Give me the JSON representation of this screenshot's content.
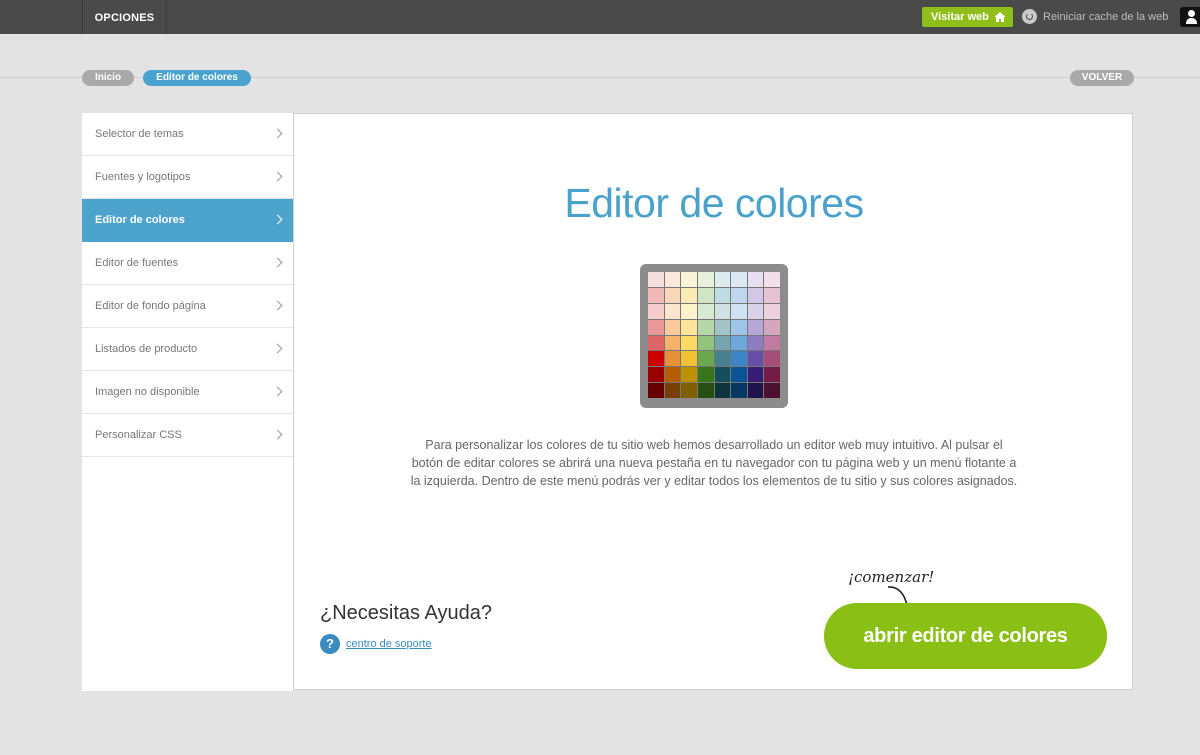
{
  "topbar": {
    "options_label": "OPCIONES",
    "visit_label": "Visitar web",
    "reset_label": "Reiniciar cache de la web"
  },
  "breadcrumb": {
    "home": "Inicio",
    "current": "Editor de colores",
    "back": "VOLVER"
  },
  "sidebar": {
    "items": [
      {
        "label": "Selector de temas"
      },
      {
        "label": "Fuentes y logotipos"
      },
      {
        "label": "Editor de colores"
      },
      {
        "label": "Editor de fuentes"
      },
      {
        "label": "Editor de fondo página"
      },
      {
        "label": "Listados de producto"
      },
      {
        "label": "Imagen no disponible"
      },
      {
        "label": "Personalizar CSS"
      }
    ],
    "active_index": 2
  },
  "main": {
    "title": "Editor de colores",
    "description": "Para personalizar los colores de tu sitio web hemos desarrollado un editor web muy intuitivo. Al pulsar el botón de editar colores se abrirá una nueva pestaña en tu navegador con tu página web y un menú flotante a la izquierda. Dentro de este menú podrás ver y editar todos los elementos de tu sitio y sus colores asignados.",
    "help_title": "¿Necesitas Ayuda?",
    "help_link": "centro de soporte",
    "start_note": "¡comenzar!",
    "open_button": "abrir editor de colores"
  },
  "palette": [
    [
      "#f7dede",
      "#fbeadb",
      "#fbf4d8",
      "#e5f1dc",
      "#dcebee",
      "#dde8f5",
      "#e6e0f1",
      "#f1dfe9"
    ],
    [
      "#f2b9b9",
      "#f8d7b7",
      "#faebb6",
      "#cfe5c3",
      "#bfdde2",
      "#c0d6ef",
      "#d2c7e7",
      "#e7c2d5"
    ],
    [
      "#f4cccc",
      "#fce5cd",
      "#fff2cc",
      "#d9ead3",
      "#d0e0e3",
      "#cfe2f3",
      "#d9d2e9",
      "#ead1dc"
    ],
    [
      "#ea9999",
      "#f9cb9c",
      "#ffe599",
      "#b6d7a8",
      "#a2c4c9",
      "#9fc5e8",
      "#b4a7d6",
      "#d5a6bd"
    ],
    [
      "#e06666",
      "#f6b26b",
      "#ffd966",
      "#93c47d",
      "#76a5af",
      "#6fa8dc",
      "#8e7cc3",
      "#c27ba0"
    ],
    [
      "#cc0000",
      "#e69138",
      "#f1c232",
      "#6aa84f",
      "#45818e",
      "#3d85c6",
      "#674ea7",
      "#a64d79"
    ],
    [
      "#990000",
      "#b45f06",
      "#bf9000",
      "#38761d",
      "#134f5c",
      "#0b5394",
      "#351c75",
      "#741b47"
    ],
    [
      "#660000",
      "#783f04",
      "#7f6000",
      "#274e13",
      "#0c343d",
      "#073763",
      "#20124d",
      "#4c1130"
    ]
  ]
}
